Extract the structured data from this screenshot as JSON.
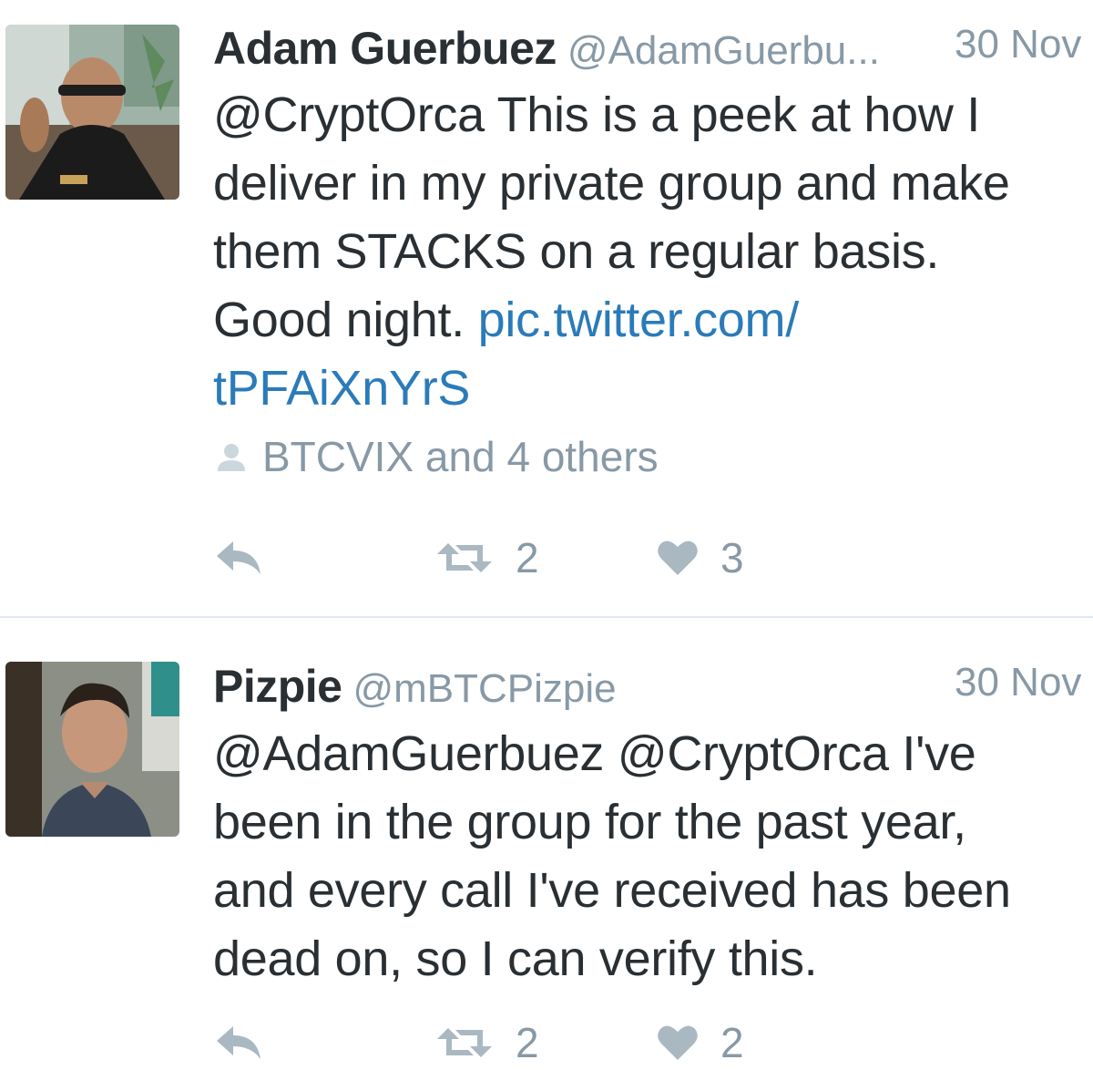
{
  "tweets": [
    {
      "name": "Adam Guerbuez",
      "handle": "@AdamGuerbu...",
      "time": "30 Nov",
      "text_lines": [
        "@CryptOrca This is a peek at how I",
        "deliver in my private group and make",
        "them STACKS on a regular basis.",
        "Good night. "
      ],
      "link_line_1": "pic.twitter.com/",
      "link_line_2": "tPFAiXnYrS",
      "context": "BTCVIX and 4 others",
      "retweets": "2",
      "likes": "3"
    },
    {
      "name": "Pizpie",
      "handle": "@mBTCPizpie",
      "time": "30 Nov",
      "text_lines": [
        "@AdamGuerbuez @CryptOrca I've",
        "been in the group for the past year,",
        "and every call I've received has been",
        "dead on, so I can verify this."
      ],
      "retweets": "2",
      "likes": "2"
    }
  ],
  "colors": {
    "text": "#292f33",
    "muted": "#8899a6",
    "link": "#2b7bb9",
    "icon": "#aab8c2",
    "divider": "#e1e8ed"
  },
  "icons": {
    "reply": "reply-icon",
    "retweet": "retweet-icon",
    "like": "heart-icon",
    "context": "person-icon"
  }
}
